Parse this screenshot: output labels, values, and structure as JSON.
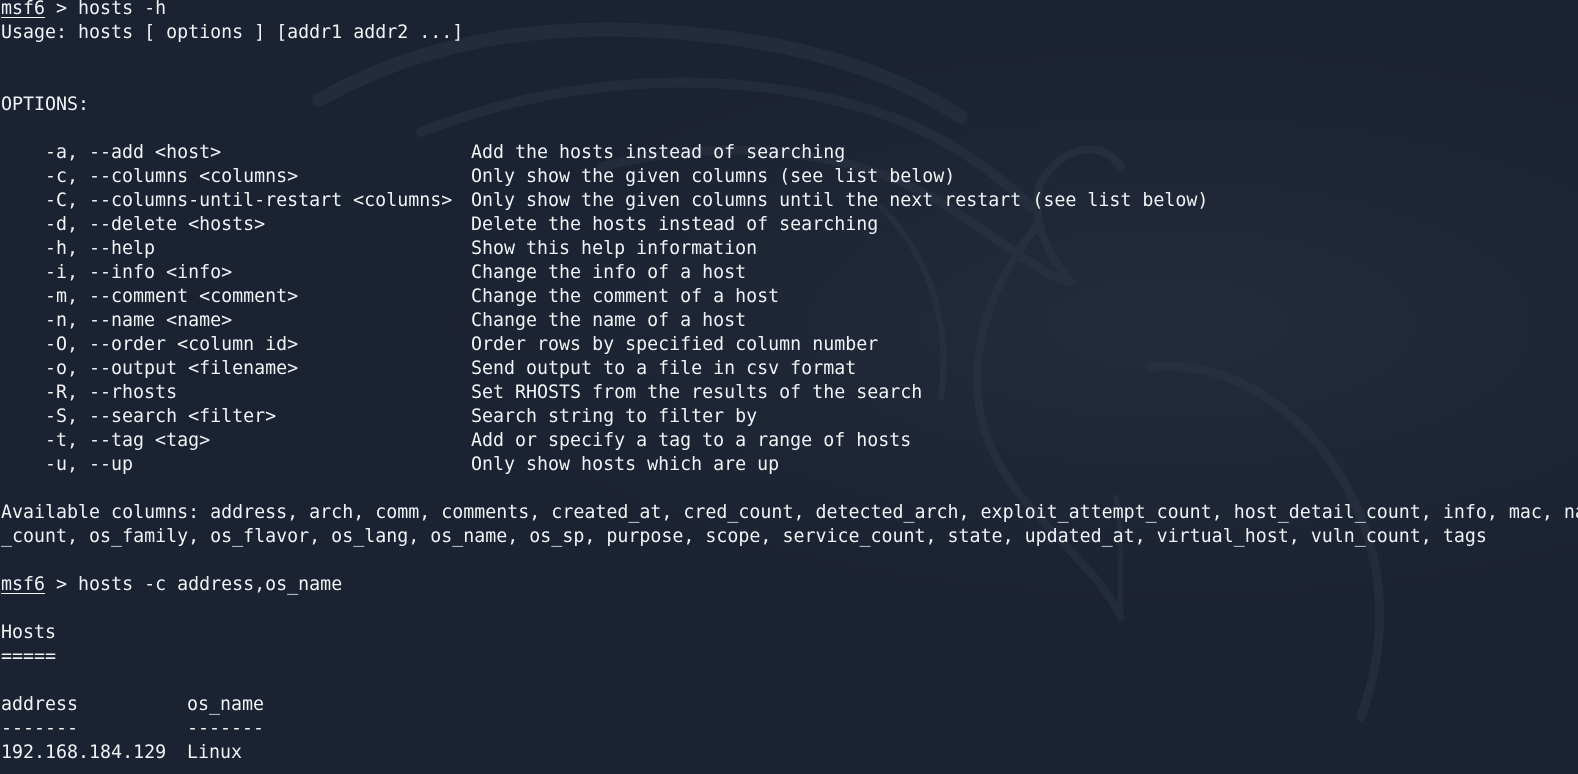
{
  "session1": {
    "prompt": "msf6",
    "command": " > hosts -h"
  },
  "usage": "Usage: hosts [ options ] [addr1 addr2 ...]",
  "options_header": "OPTIONS:",
  "options": [
    {
      "flag": "-a, --add <host>",
      "desc": "Add the hosts instead of searching"
    },
    {
      "flag": "-c, --columns <columns>",
      "desc": "Only show the given columns (see list below)"
    },
    {
      "flag": "-C, --columns-until-restart <columns>",
      "desc": "Only show the given columns until the next restart (see list below)"
    },
    {
      "flag": "-d, --delete <hosts>",
      "desc": "Delete the hosts instead of searching"
    },
    {
      "flag": "-h, --help",
      "desc": "Show this help information"
    },
    {
      "flag": "-i, --info <info>",
      "desc": "Change the info of a host"
    },
    {
      "flag": "-m, --comment <comment>",
      "desc": "Change the comment of a host"
    },
    {
      "flag": "-n, --name <name>",
      "desc": "Change the name of a host"
    },
    {
      "flag": "-O, --order <column id>",
      "desc": "Order rows by specified column number"
    },
    {
      "flag": "-o, --output <filename>",
      "desc": "Send output to a file in csv format"
    },
    {
      "flag": "-R, --rhosts",
      "desc": "Set RHOSTS from the results of the search"
    },
    {
      "flag": "-S, --search <filter>",
      "desc": "Search string to filter by"
    },
    {
      "flag": "-t, --tag <tag>",
      "desc": "Add or specify a tag to a range of hosts"
    },
    {
      "flag": "-u, --up",
      "desc": "Only show hosts which are up"
    }
  ],
  "columns_line1": "Available columns: address, arch, comm, comments, created_at, cred_count, detected_arch, exploit_attempt_count, host_detail_count, info, mac, na",
  "columns_line2": "_count, os_family, os_flavor, os_lang, os_name, os_sp, purpose, scope, service_count, state, updated_at, virtual_host, vuln_count, tags",
  "session2": {
    "prompt": "msf6",
    "command": " > hosts -c address,os_name"
  },
  "hosts_title": "Hosts",
  "hosts_underline": "=====",
  "table": {
    "headers": [
      "address",
      "os_name"
    ],
    "separators": [
      "-------",
      "-------"
    ],
    "rows": [
      [
        "192.168.184.129",
        "Linux"
      ]
    ]
  },
  "colors": {
    "background": "#1b2231",
    "foreground": "#f2f3f5"
  },
  "icons": {
    "background_logo": "kali-dragon-icon"
  }
}
